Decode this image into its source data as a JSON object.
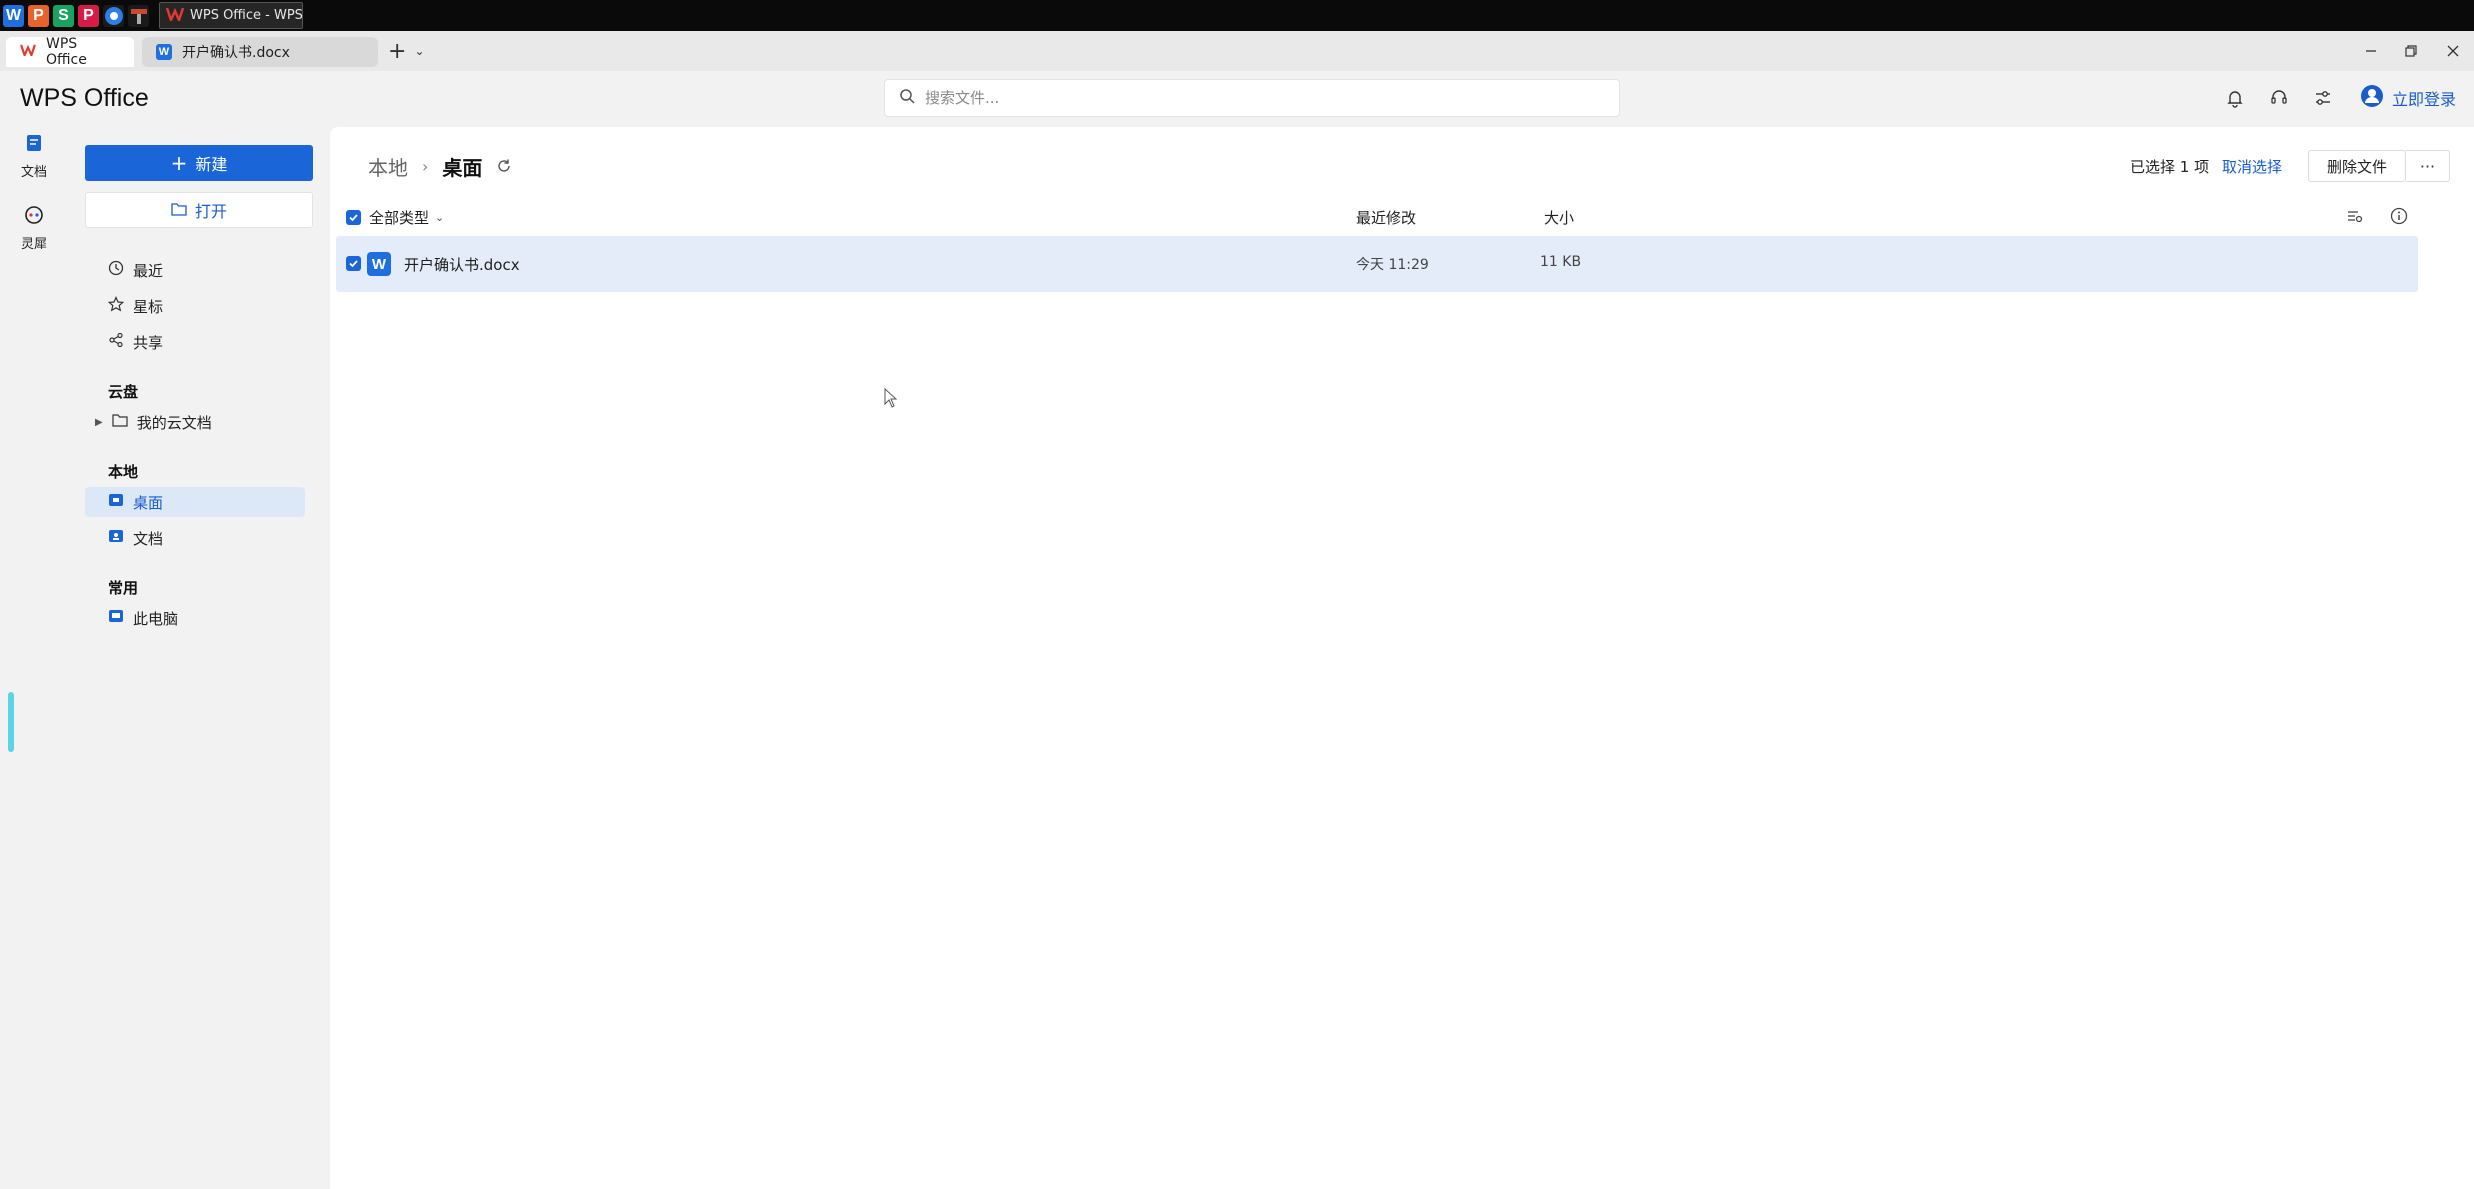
{
  "taskbar": {
    "apps": [
      {
        "glyph": "W",
        "color": "#1f6fe0",
        "name": "wps-writer-icon"
      },
      {
        "glyph": "P",
        "color": "#e8632b",
        "name": "wps-presentation-icon"
      },
      {
        "glyph": "S",
        "color": "#1aa260",
        "name": "wps-spreadsheet-icon"
      },
      {
        "glyph": "P",
        "color": "#d81b45",
        "name": "wps-pdf-icon"
      }
    ],
    "task_title": "WPS Office - WPS ..."
  },
  "tabs": {
    "home_label": "WPS Office",
    "doc_label": "开户确认书.docx"
  },
  "header": {
    "brand": "WPS Office",
    "search_placeholder": "搜索文件...",
    "login_label": "立即登录"
  },
  "rail": {
    "docs_label": "文档",
    "lingxi_label": "灵犀"
  },
  "sidebar": {
    "new_label": "新建",
    "open_label": "打开",
    "recent_label": "最近",
    "starred_label": "星标",
    "shared_label": "共享",
    "cloud_section": "云盘",
    "my_cloud_label": "我的云文档",
    "local_section": "本地",
    "desktop_label": "桌面",
    "documents_label": "文档",
    "common_section": "常用",
    "this_pc_label": "此电脑"
  },
  "main": {
    "breadcrumb_root": "本地",
    "breadcrumb_current": "桌面",
    "selected_info": "已选择 1 项",
    "cancel_select_label": "取消选择",
    "delete_label": "删除文件",
    "more_label": "···",
    "col_type": "全部类型",
    "col_modified": "最近修改",
    "col_size": "大小",
    "files": [
      {
        "name": "开户确认书.docx",
        "modified": "今天 11:29",
        "size": "11 KB",
        "checked": true
      }
    ]
  },
  "colors": {
    "accent": "#1a66d9",
    "selected_row": "#e3ecf8",
    "rail_accent": "#5fd3e6"
  }
}
